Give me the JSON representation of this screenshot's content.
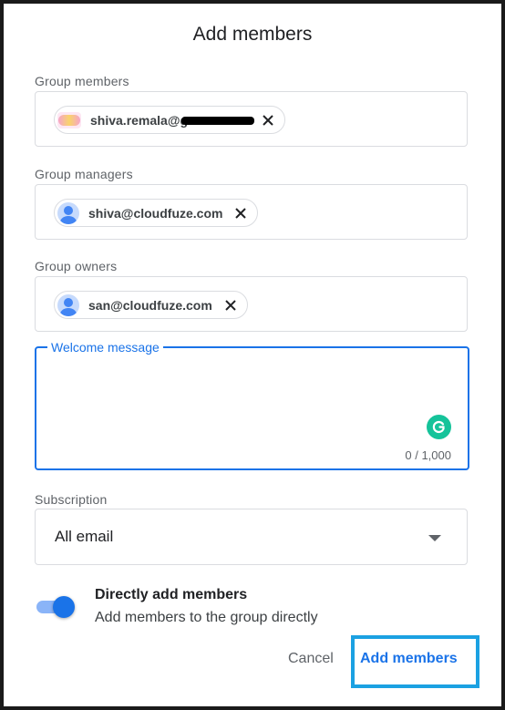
{
  "dialog": {
    "title": "Add members"
  },
  "group_members": {
    "label": "Group members",
    "chips": [
      {
        "text": "shiva.remala@g",
        "avatar": "logo-image",
        "remove_icon": "close-icon"
      }
    ]
  },
  "group_managers": {
    "label": "Group managers",
    "chips": [
      {
        "text": "shiva@cloudfuze.com",
        "avatar": "default-person-avatar",
        "remove_icon": "close-icon"
      }
    ]
  },
  "group_owners": {
    "label": "Group owners",
    "chips": [
      {
        "text": "san@cloudfuze.com",
        "avatar": "default-person-avatar",
        "remove_icon": "close-icon"
      }
    ]
  },
  "welcome_message": {
    "label": "Welcome message",
    "value": "",
    "counter": "0 / 1,000",
    "grammarly_icon": "grammarly-icon"
  },
  "subscription": {
    "label": "Subscription",
    "selected": "All email"
  },
  "direct_add": {
    "title": "Directly add members",
    "description": "Add members to the group directly",
    "enabled": true
  },
  "actions": {
    "cancel_label": "Cancel",
    "add_label": "Add members"
  },
  "colors": {
    "accent": "#1a73e8",
    "highlight_frame": "#1ba1e2",
    "grammarly": "#15c39a"
  }
}
